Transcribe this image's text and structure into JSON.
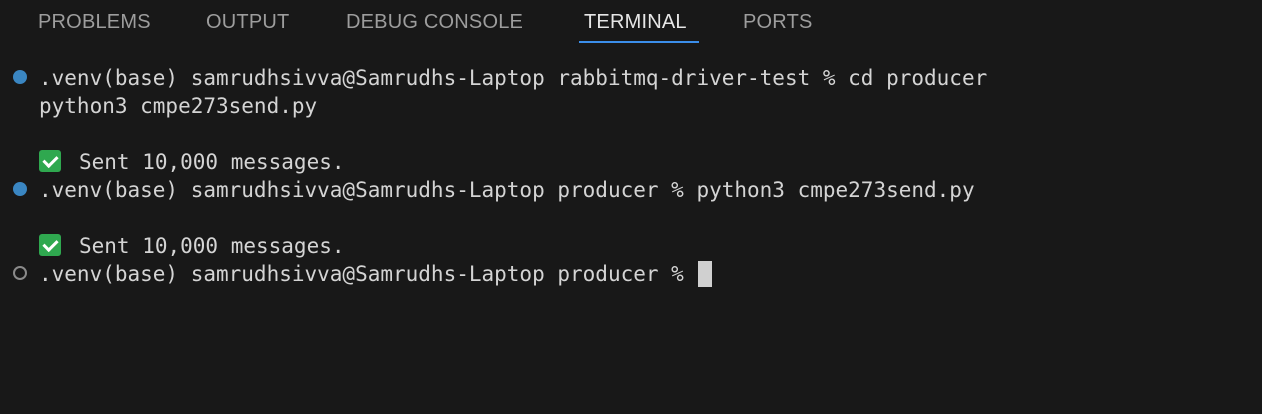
{
  "tabs": {
    "problems": "PROBLEMS",
    "output": "OUTPUT",
    "debug_console": "DEBUG CONSOLE",
    "terminal": "TERMINAL",
    "ports": "PORTS",
    "active": "TERMINAL"
  },
  "colors": {
    "background": "#181818",
    "active_tab_underline": "#3b8eea",
    "success_decoration": "#3a86c2",
    "check_emoji": "#2fa84f"
  },
  "terminal": {
    "lines": [
      {
        "decoration": "filled",
        "text": ".venv(base) samrudhsivva@Samrudhs-Laptop rabbitmq-driver-test % cd producer"
      },
      {
        "decoration": "none",
        "text": "python3 cmpe273send.py"
      },
      {
        "decoration": "none",
        "text": ""
      },
      {
        "decoration": "none",
        "icon": "check-mark-icon",
        "text": "Sent 10,000 messages."
      },
      {
        "decoration": "filled",
        "text": ".venv(base) samrudhsivva@Samrudhs-Laptop producer % python3 cmpe273send.py"
      },
      {
        "decoration": "none",
        "text": ""
      },
      {
        "decoration": "none",
        "icon": "check-mark-icon",
        "text": "Sent 10,000 messages."
      },
      {
        "decoration": "empty",
        "text": ".venv(base) samrudhsivva@Samrudhs-Laptop producer % ",
        "cursor": true
      }
    ]
  }
}
